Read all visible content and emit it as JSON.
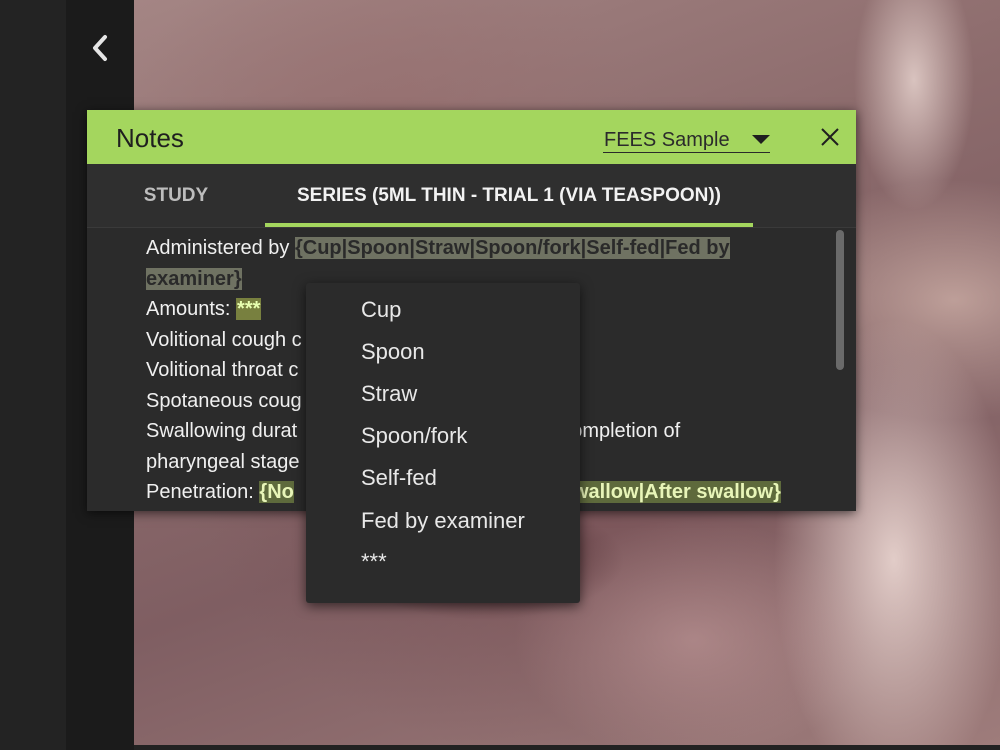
{
  "sidebar": {
    "back_icon": "chevron-left-icon"
  },
  "panel": {
    "title": "Notes",
    "template_selected": "FEES Sample",
    "close_icon": "close-icon",
    "accent_color": "#a4d65e"
  },
  "tabs": [
    {
      "label": "STUDY",
      "active": false
    },
    {
      "label": "SERIES (5ML THIN - TRIAL 1 (VIA TEASPOON))",
      "active": true
    }
  ],
  "note": {
    "line1_prefix": "Administered by ",
    "line1_field": "{Cup|Spoon|Straw|Spoon/fork|Self-fed|Fed by ",
    "line2_field": "examiner}",
    "line3_prefix": "Amounts: ",
    "line3_field": "***",
    "line4": "Volitional cough c",
    "line5": "Volitional throat c",
    "line6": "Spotaneous coug",
    "line7_prefix": "Swallowing durat",
    "line7_suffix": "ompletion of",
    "line8": "pharyngeal stage",
    "line9_prefix": "Penetration: ",
    "line9_field_a": "{No",
    "line9_field_b": "swallow|After swallow}"
  },
  "dropdown": {
    "options": [
      "Cup",
      "Spoon",
      "Straw",
      "Spoon/fork",
      "Self-fed",
      "Fed by examiner",
      "***"
    ]
  }
}
